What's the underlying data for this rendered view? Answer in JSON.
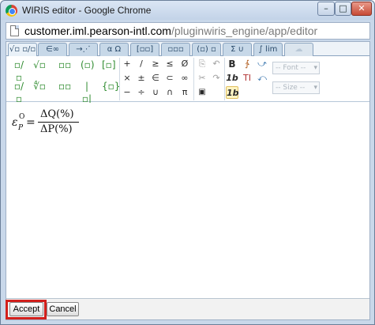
{
  "window": {
    "title": "WIRIS editor - Google Chrome",
    "controls": {
      "minimize": "–",
      "maximize": "□",
      "close": "✕"
    }
  },
  "address_bar": {
    "host": "customer.iml.pearson-intl.com",
    "path": "/pluginwiris_engine/app/editor"
  },
  "tabs": [
    "√▫ ▫/▫",
    "∈∞",
    "→⋰",
    "α Ω",
    "[▫▫]",
    "▫▫▫",
    "(▫) ▫",
    "Σ ∪",
    "∫ lim",
    "☁"
  ],
  "toolbar": {
    "fraction_group": [
      "▫/▫",
      "√▫",
      "▫▫",
      "(▫)",
      "[▫]",
      "▫/▫",
      "∜▫",
      "▫▫",
      "|▫|",
      "{▫}"
    ],
    "operators": [
      "+",
      "/",
      "≥",
      "≤",
      "Ø",
      "×",
      "±",
      "∈",
      "⊂",
      "∞",
      "−",
      "÷",
      "∪",
      "∩",
      "π"
    ],
    "edit_icons": [
      "copy-icon",
      "undo-icon",
      "cut-icon",
      "redo-icon",
      "paste-icon",
      "select-icon"
    ],
    "format": {
      "bold": "B",
      "italic": "1b",
      "style_active": "1b",
      "text": "TI"
    },
    "font_dropdown": "-- Font --",
    "size_dropdown": "-- Size --"
  },
  "formula": {
    "symbol": "ε",
    "superscript": "O",
    "subscript": "P",
    "equals": "=",
    "numerator": "ΔQ(%)",
    "denominator": "ΔP(%)"
  },
  "buttons": {
    "accept": "Accept",
    "cancel": "Cancel"
  },
  "colors": {
    "highlight": "#d2201c",
    "tab_blue": "#c7d8e8",
    "symbol_green": "#2e8b2e"
  }
}
